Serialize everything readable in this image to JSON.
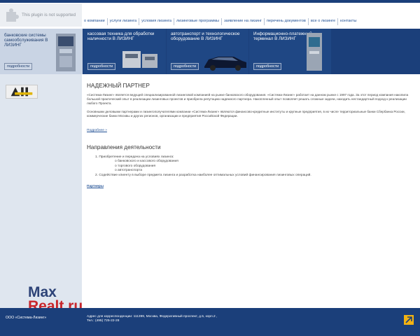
{
  "plugin": {
    "message": "This plugin is not supported"
  },
  "nav": {
    "items": [
      "о компании",
      "услуги лизинга",
      "условия лизинга",
      "лизинговые программы",
      "заявление на лизинг",
      "перечень документов",
      "все о лизинге",
      "контакты"
    ]
  },
  "banner": {
    "panels": [
      {
        "title": "банковские системы самообслуживания В ЛИЗИНГ",
        "more": "подробности"
      },
      {
        "title": "кассовая техника для обработки наличности В ЛИЗИНГ",
        "more": "подробности"
      },
      {
        "title": "автотранспорт и технологическое оборудование В ЛИЗИНГ",
        "more": "подробности"
      },
      {
        "title": "Информационно-платежный терминал В ЛИЗИНГ",
        "more": "подробности"
      }
    ]
  },
  "main": {
    "heading": "НАДЕЖНЫЙ ПАРТНЕР",
    "para1": "«Система-Лизинг» является ведущей специализированной лизинговой компанией на рынке банковского оборудования. «Система-Лизинг» работает на данном рынке с 1997 года. За этот период компания накопила большой практический опыт в реализации лизинговых проектов и приобрела репутацию надежного партнера. Накопленный опыт позволяет решать сложные задачи, находить нестандартный подход к реализации любого Проекта.",
    "para2": "Основными деловыми партнерами и лизингополучателями компании «Система-Лизинг» являются финансово-кредитные институты и крупные предприятия, в их числе территориальные банки Сбербанка России, коммерческие банки Москвы и других регионов, организации и предприятия Российской Федерации.",
    "more_link": "Подробнее »",
    "directions_heading": "Направления деятельности",
    "directions": {
      "item1": "1. Приобретение и передача на условиях лизинга:",
      "sub": [
        "o   банковского и кассового оборудования",
        "o   торгового оборудования",
        "o   автотранспорта"
      ],
      "item2": "2. Содействие клиенту в выборе предмета лизинга и разработка наиболее оптимальных условий финансирования лизинговых операций."
    },
    "partners_link": "Партнеры"
  },
  "watermark": {
    "line1": "Max",
    "line2": "Realt.ru"
  },
  "footer": {
    "company": "ООО «Система-Лизинг»",
    "address": "Адрес для корреспонденции: 111399, Москва, Федеративный проспект, д.5, корп.2 ,",
    "phone": "Тел.: (495) 725-22-28"
  },
  "colors": {
    "brand_blue": "#1b3f7a",
    "link_blue": "#1f4f94",
    "accent_yellow": "#f2b212"
  }
}
